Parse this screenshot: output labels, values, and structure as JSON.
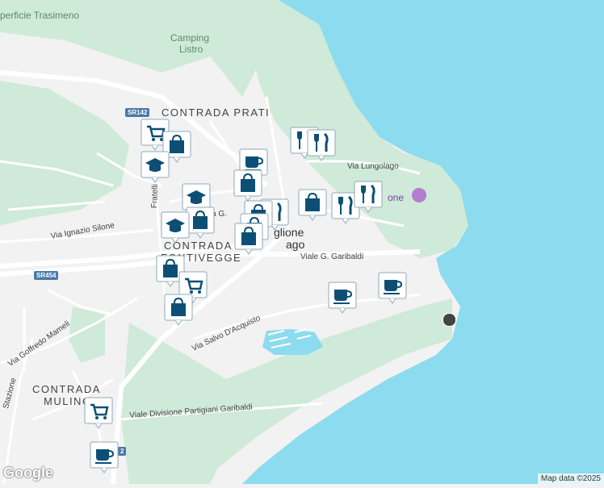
{
  "map": {
    "colors": {
      "water": "#8ddbee",
      "land": "#f2f2f2",
      "park": "#cfead8",
      "road": "#ffffff",
      "marker": "#0d4f74"
    },
    "labels": {
      "superficie": "perficie Trasimeno",
      "camping": "Camping",
      "camping2": "Listro",
      "prati": "CONTRADA PRATI",
      "fontivegge1": "CONTRADA",
      "fontivegge2": "FONTIVEGGE",
      "mulino1": "CONTRADA",
      "mulino2": "MULINO",
      "town1": "glione",
      "town2": "ago",
      "lungolago": "Via Lungolago",
      "garibaldi": "Viale G. Garibaldi",
      "silone": "Via Ignazio Silone",
      "salvo": "Via Salvo D'Acquisto",
      "mameli": "Via Goffredo Mameli",
      "partigiani": "Viale Divisione Partigiani Garibaldi",
      "stazione": "Stazione",
      "fratelli": "Fratelli",
      "viag": "a G.",
      "one": "one"
    },
    "shields": {
      "sr142": "SR142",
      "sr454": "SR454",
      "r2": "2"
    },
    "google": "Google",
    "copyright": "Map data ©2025"
  }
}
